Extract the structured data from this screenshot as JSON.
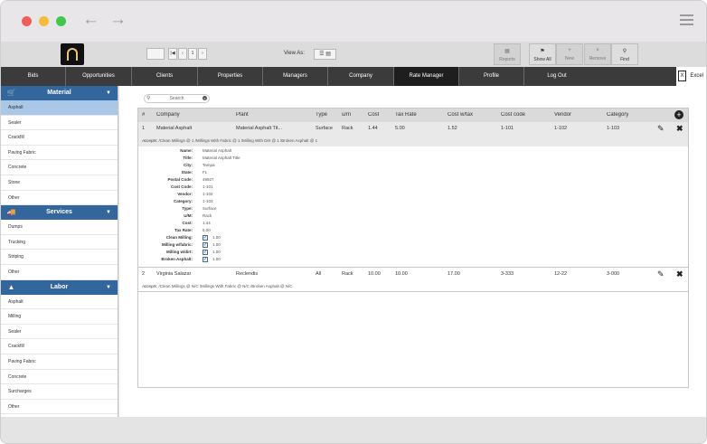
{
  "window": {
    "back_icon": "back-arrow-icon",
    "forward_icon": "forward-arrow-icon",
    "menu_icon": "hamburger-icon"
  },
  "toolbar": {
    "pager": [
      "|◀",
      "‹",
      "1",
      "›",
      "▶|"
    ],
    "view_as": "View As:",
    "buttons": [
      {
        "label": "Reports",
        "icon": "reports-icon"
      },
      {
        "label": "Show All",
        "icon": "show-all-icon"
      },
      {
        "label": "New",
        "icon": "plus-icon"
      },
      {
        "label": "Remove",
        "icon": "x-icon"
      },
      {
        "label": "Find",
        "icon": "search-icon"
      }
    ]
  },
  "nav": {
    "items": [
      "Bids",
      "Opportunities",
      "Clients",
      "Properties",
      "Managers",
      "Company",
      "Rate Manager",
      "Profile",
      "Log Out"
    ],
    "active": "Rate Manager",
    "excel": "Excel"
  },
  "sidebar": {
    "material": {
      "title": "Material",
      "items": [
        "Asphalt",
        "Sealer",
        "Crackfill",
        "Paving Fabric",
        "Concrete",
        "Stone",
        "Other"
      ]
    },
    "services": {
      "title": "Services",
      "items": [
        "Dumps",
        "Trucking",
        "Striping",
        "Other"
      ]
    },
    "labor": {
      "title": "Labor",
      "items": [
        "Asphalt",
        "Milling",
        "Sealer",
        "Crackfill",
        "Paving Fabric",
        "Concrete",
        "Surcharges",
        "Other"
      ]
    }
  },
  "search": {
    "placeholder": "Search"
  },
  "table": {
    "headers": [
      "#",
      "Company",
      "Plant",
      "Type",
      "u/m",
      "Cost",
      "Tax Rate",
      "Cost w/tax",
      "Cost code",
      "Vendor",
      "Category"
    ],
    "rows": [
      {
        "num": "1",
        "company": "Material Asphalt",
        "plant": "Material Asphalt Tit...",
        "type": "Surface",
        "um": "Rack",
        "cost": "1.44",
        "tax": "5.00",
        "costtax": "1.52",
        "code": "1-101",
        "vendor": "1-102",
        "category": "1-103",
        "accepts": "/Clean Millings @ 1  /Millings With Fabric @ 1  /Milling With Dirt @ 1  /Broken Asphalt @ 1"
      },
      {
        "num": "2",
        "company": "Virginia Salazar",
        "plant": "Reclendis",
        "type": "All",
        "um": "Rack",
        "cost": "10.00",
        "tax": "10.00",
        "costtax": "17.00",
        "code": "3-333",
        "vendor": "12-22",
        "category": "3-000",
        "accepts": "/Clean Millings @ N/C  /Millings With Fabric @ N/C  /Broken Asphalt @ N/C"
      }
    ],
    "accepts_label": "Accepts:",
    "detail": {
      "fields": [
        {
          "label": "Name:",
          "value": "Material Asphalt"
        },
        {
          "label": "Title:",
          "value": "Material Asphalt Title"
        },
        {
          "label": "City:",
          "value": "Tampa"
        },
        {
          "label": "State:",
          "value": "FL"
        },
        {
          "label": "Postal Code:",
          "value": "49927"
        },
        {
          "label": "Cost Code:",
          "value": "1-101"
        },
        {
          "label": "Vendor:",
          "value": "1-102"
        },
        {
          "label": "Category:",
          "value": "1-103"
        },
        {
          "label": "Type:",
          "value": "Surface"
        },
        {
          "label": "U/M:",
          "value": "Rack"
        },
        {
          "label": "Cost:",
          "value": "1.44"
        },
        {
          "label": "Tax Rate:",
          "value": "5.00"
        }
      ],
      "checks": [
        {
          "label": "Clean Milling:",
          "value": "1.00"
        },
        {
          "label": "Milling w/fabric:",
          "value": "1.00"
        },
        {
          "label": "Milling w/dirt:",
          "value": "1.00"
        },
        {
          "label": "Broken Asphalt:",
          "value": "1.00"
        }
      ]
    }
  }
}
